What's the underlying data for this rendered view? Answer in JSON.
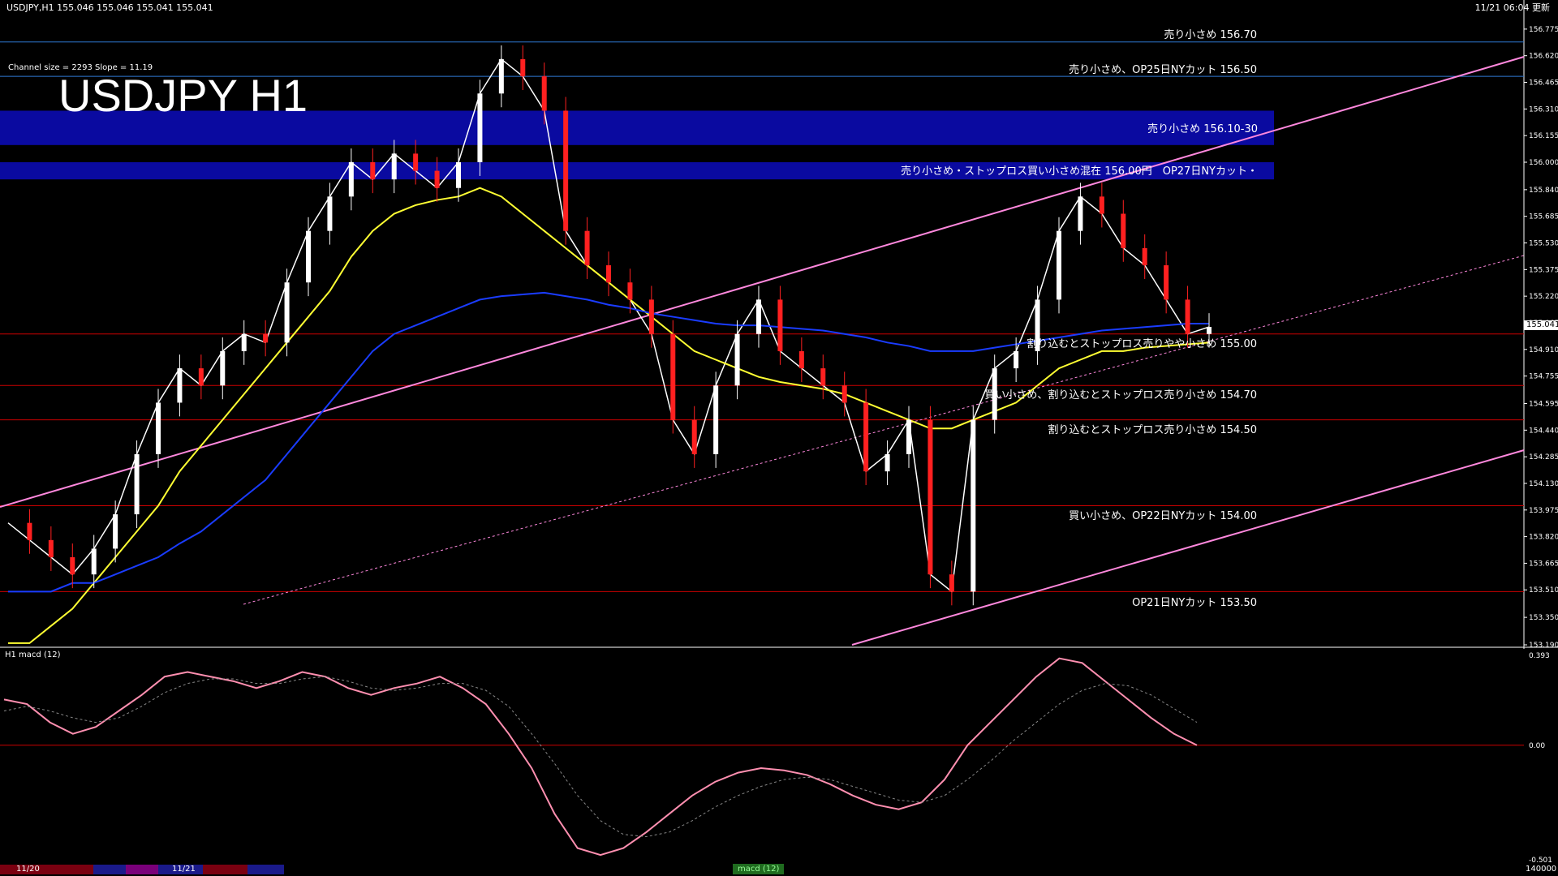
{
  "header": {
    "symbol_info": "USDJPY,H1  155.046 155.046 155.041 155.041",
    "timestamp": "11/21 06:04 更新",
    "channel_info": "Channel size = 2293 Slope = 11.19",
    "big_title": "USDJPY H1"
  },
  "zones": [
    {
      "label": "売り小さめ 156.10-30",
      "low": 156.1,
      "high": 156.3,
      "color": "#0a0aa0"
    },
    {
      "label": "売り小さめ・ストップロス買い小さめ混在 156.00円　OP27日NYカット・",
      "low": 155.9,
      "high": 156.0,
      "color": "#0a0aa0"
    }
  ],
  "levels": [
    {
      "label": "売り小さめ 156.70",
      "price": 156.7,
      "color": "#2f7ad6"
    },
    {
      "label": "売り小さめ、OP25日NYカット 156.50",
      "price": 156.5,
      "color": "#2f7ad6"
    },
    {
      "label": "割り込むとストップロス売りやや小さめ 155.00",
      "price": 155.0,
      "color": "#cc0000"
    },
    {
      "label": "買い小さめ、割り込むとストップロス売り小さめ 154.70",
      "price": 154.7,
      "color": "#cc0000"
    },
    {
      "label": "割り込むとストップロス売り小さめ 154.50",
      "price": 154.5,
      "color": "#cc0000"
    },
    {
      "label": "買い小さめ、OP22日NYカット 154.00",
      "price": 154.0,
      "color": "#cc0000"
    },
    {
      "label": "OP21日NYカット 153.50",
      "price": 153.5,
      "color": "#cc0000"
    }
  ],
  "current_price": "155.041",
  "chart_data": [
    {
      "type": "line",
      "title": "USDJPY H1",
      "ylim": [
        153.19,
        156.85
      ],
      "y_ticks": [
        "156.775",
        "156.620",
        "156.465",
        "156.310",
        "156.155",
        "156.000",
        "155.840",
        "155.685",
        "155.530",
        "155.375",
        "155.220",
        "155.065",
        "154.910",
        "154.755",
        "154.595",
        "154.440",
        "154.285",
        "154.130",
        "153.975",
        "153.820",
        "153.665",
        "153.510",
        "153.350",
        "153.190"
      ],
      "x_ticks": [
        "11/20",
        "11/21"
      ],
      "series": [
        {
          "name": "close",
          "color": "#ffffff",
          "values": [
            153.9,
            153.8,
            153.7,
            153.6,
            153.75,
            153.95,
            154.3,
            154.6,
            154.8,
            154.7,
            154.9,
            155.0,
            154.95,
            155.3,
            155.6,
            155.8,
            156.0,
            155.9,
            156.05,
            155.95,
            155.85,
            156.0,
            156.4,
            156.6,
            156.5,
            156.3,
            155.6,
            155.4,
            155.3,
            155.2,
            155.0,
            154.5,
            154.3,
            154.7,
            155.0,
            155.2,
            154.9,
            154.8,
            154.7,
            154.6,
            154.2,
            154.3,
            154.5,
            153.6,
            153.5,
            154.5,
            154.8,
            154.9,
            155.2,
            155.6,
            155.8,
            155.7,
            155.5,
            155.4,
            155.2,
            155.0,
            155.041
          ]
        },
        {
          "name": "",
          "color": "#ffff33",
          "values": [
            153.2,
            153.2,
            153.3,
            153.4,
            153.55,
            153.7,
            153.85,
            154.0,
            154.2,
            154.35,
            154.5,
            154.65,
            154.8,
            154.95,
            155.1,
            155.25,
            155.45,
            155.6,
            155.7,
            155.75,
            155.78,
            155.8,
            155.85,
            155.8,
            155.7,
            155.6,
            155.5,
            155.4,
            155.3,
            155.2,
            155.1,
            155.0,
            154.9,
            154.85,
            154.8,
            154.75,
            154.72,
            154.7,
            154.68,
            154.65,
            154.6,
            154.55,
            154.5,
            154.45,
            154.45,
            154.5,
            154.55,
            154.6,
            154.7,
            154.8,
            154.85,
            154.9,
            154.9,
            154.92,
            154.93,
            154.94,
            154.95
          ]
        },
        {
          "name": "",
          "color": "#1a3cff",
          "values": [
            153.5,
            153.5,
            153.5,
            153.55,
            153.55,
            153.6,
            153.65,
            153.7,
            153.78,
            153.85,
            153.95,
            154.05,
            154.15,
            154.3,
            154.45,
            154.6,
            154.75,
            154.9,
            155.0,
            155.05,
            155.1,
            155.15,
            155.2,
            155.22,
            155.23,
            155.24,
            155.22,
            155.2,
            155.17,
            155.15,
            155.12,
            155.1,
            155.08,
            155.06,
            155.05,
            155.05,
            155.04,
            155.03,
            155.02,
            155.0,
            154.98,
            154.95,
            154.93,
            154.9,
            154.9,
            154.9,
            154.92,
            154.94,
            154.96,
            154.98,
            155.0,
            155.02,
            155.03,
            155.04,
            155.05,
            155.06,
            155.06
          ]
        }
      ]
    },
    {
      "type": "line",
      "title": "H1  macd (12)",
      "ylim": [
        -0.501,
        0.393
      ],
      "y_ticks": [
        "0.393",
        "0.00",
        "-0.501"
      ],
      "series": [
        {
          "name": "",
          "color": "#ff8fb0",
          "values": [
            0.2,
            0.18,
            0.1,
            0.05,
            0.08,
            0.15,
            0.22,
            0.3,
            0.32,
            0.3,
            0.28,
            0.25,
            0.28,
            0.32,
            0.3,
            0.25,
            0.22,
            0.25,
            0.27,
            0.3,
            0.25,
            0.18,
            0.05,
            -0.1,
            -0.3,
            -0.45,
            -0.48,
            -0.45,
            -0.38,
            -0.3,
            -0.22,
            -0.16,
            -0.12,
            -0.1,
            -0.11,
            -0.13,
            -0.17,
            -0.22,
            -0.26,
            -0.28,
            -0.25,
            -0.15,
            0.0,
            0.1,
            0.2,
            0.3,
            0.38,
            0.36,
            0.28,
            0.2,
            0.12,
            0.05,
            0.0
          ]
        },
        {
          "name": "",
          "color": "#888888",
          "values": [
            0.15,
            0.17,
            0.15,
            0.12,
            0.1,
            0.12,
            0.17,
            0.23,
            0.27,
            0.29,
            0.29,
            0.27,
            0.27,
            0.29,
            0.3,
            0.28,
            0.25,
            0.24,
            0.25,
            0.27,
            0.27,
            0.24,
            0.17,
            0.05,
            -0.08,
            -0.22,
            -0.33,
            -0.39,
            -0.4,
            -0.38,
            -0.33,
            -0.27,
            -0.22,
            -0.18,
            -0.15,
            -0.14,
            -0.15,
            -0.18,
            -0.21,
            -0.24,
            -0.25,
            -0.22,
            -0.15,
            -0.07,
            0.02,
            0.1,
            0.18,
            0.24,
            0.27,
            0.26,
            0.22,
            0.16,
            0.1
          ]
        }
      ]
    }
  ],
  "footer": {
    "date1": "11/20",
    "date2": "11/21",
    "tab": "macd (12)",
    "macd_right": "140000"
  }
}
